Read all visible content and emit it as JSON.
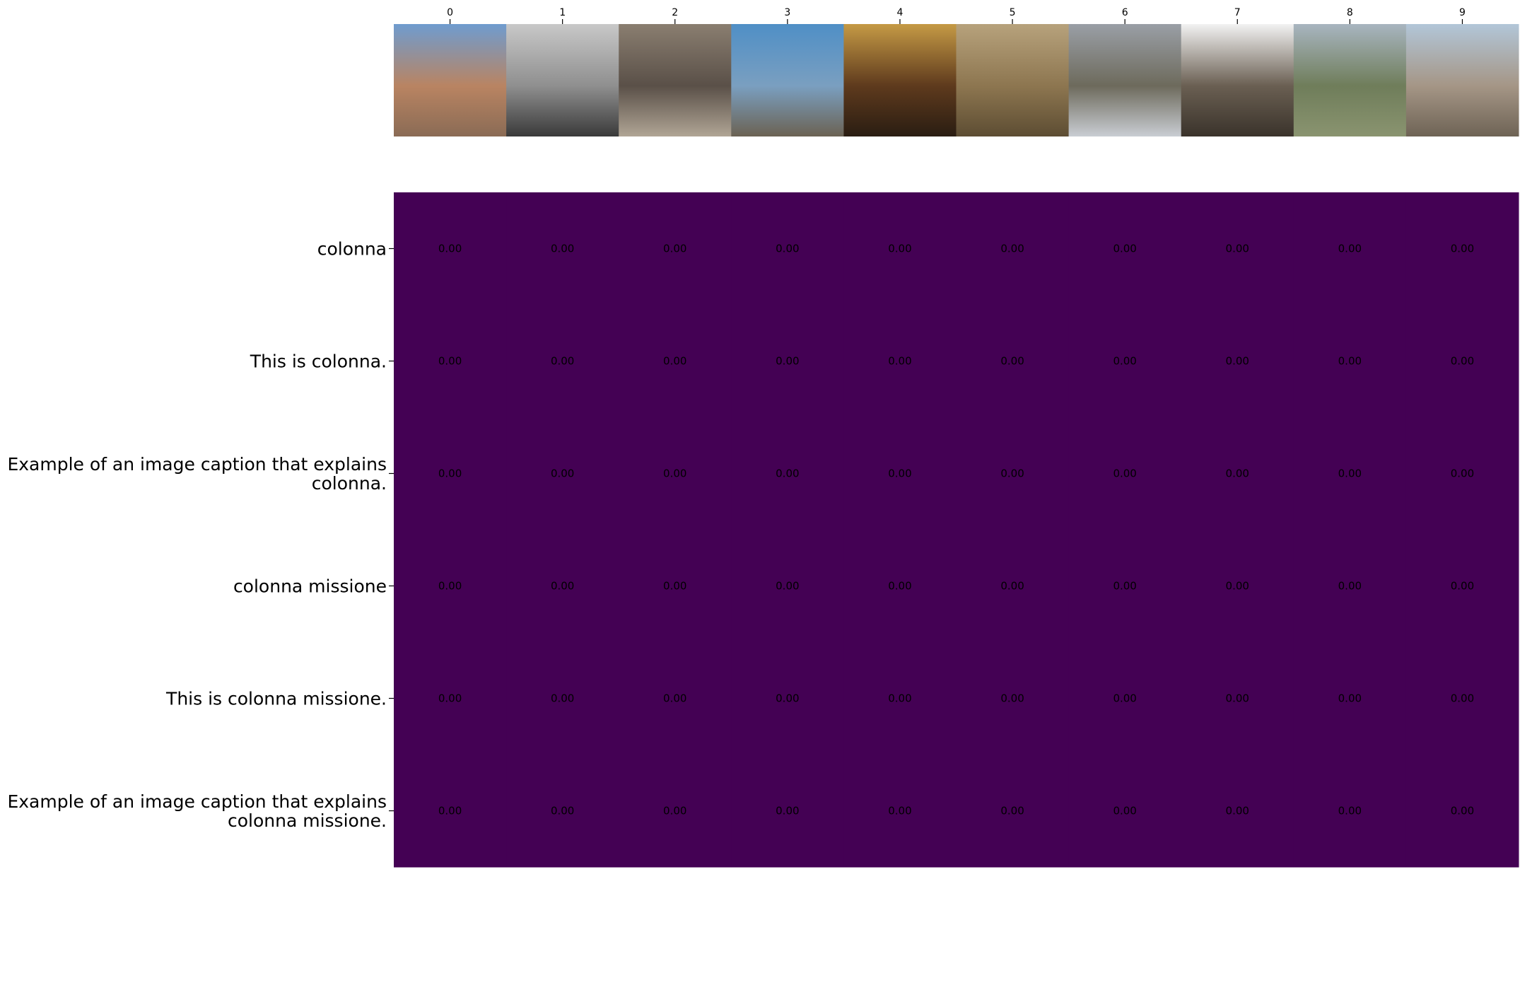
{
  "chart_data": {
    "type": "heatmap",
    "x_tick_labels": [
      "0",
      "1",
      "2",
      "3",
      "4",
      "5",
      "6",
      "7",
      "8",
      "9"
    ],
    "image_thumbnails": [
      {
        "index": "0",
        "subject": "column monument in city square",
        "colors": [
          "#6f9ccf",
          "#b98462",
          "#8a6b55"
        ]
      },
      {
        "index": "1",
        "subject": "white horse, black and white photo",
        "colors": [
          "#c8c8c8",
          "#8f8f8f",
          "#3a3a3a"
        ]
      },
      {
        "index": "2",
        "subject": "ancient temple columns",
        "colors": [
          "#8a7e70",
          "#5a5048",
          "#b0a595"
        ]
      },
      {
        "index": "3",
        "subject": "obelisk against blue sky",
        "colors": [
          "#4f8fc6",
          "#7a9fc0",
          "#6b6253"
        ]
      },
      {
        "index": "4",
        "subject": "subway train interior",
        "colors": [
          "#c59a45",
          "#5e3a1d",
          "#2a1d12"
        ]
      },
      {
        "index": "5",
        "subject": "engraved relief panel",
        "colors": [
          "#b7a27c",
          "#8d7650",
          "#5d4d33"
        ]
      },
      {
        "index": "6",
        "subject": "aqueduct bridge landscape",
        "colors": [
          "#9a9fa6",
          "#6d6a5c",
          "#c9cdd3"
        ]
      },
      {
        "index": "7",
        "subject": "hammer on white background",
        "colors": [
          "#f2f2f2",
          "#6a5f52",
          "#3a332b"
        ]
      },
      {
        "index": "8",
        "subject": "hillside town landscape",
        "colors": [
          "#a8b5c0",
          "#6f7d5a",
          "#8a9470"
        ]
      },
      {
        "index": "9",
        "subject": "church square with tower",
        "colors": [
          "#b2c6d8",
          "#a59686",
          "#6e6355"
        ]
      }
    ],
    "y_tick_labels": [
      [
        "colonna"
      ],
      [
        "This is colonna."
      ],
      [
        "Example of an image caption that explains",
        "colonna."
      ],
      [
        "colonna missione"
      ],
      [
        "This is colonna missione."
      ],
      [
        "Example of an image caption that explains",
        "colonna missione."
      ]
    ],
    "values": [
      [
        0.0,
        0.0,
        0.0,
        0.0,
        0.0,
        0.0,
        0.0,
        0.0,
        0.0,
        0.0
      ],
      [
        0.0,
        0.0,
        0.0,
        0.0,
        0.0,
        0.0,
        0.0,
        0.0,
        0.0,
        0.0
      ],
      [
        0.0,
        0.0,
        0.0,
        0.0,
        0.0,
        0.0,
        0.0,
        0.0,
        0.0,
        0.0
      ],
      [
        0.0,
        0.0,
        0.0,
        0.0,
        0.0,
        0.0,
        0.0,
        0.0,
        0.0,
        0.0
      ],
      [
        0.0,
        0.0,
        0.0,
        0.0,
        0.0,
        0.0,
        0.0,
        0.0,
        0.0,
        0.0
      ],
      [
        0.0,
        0.0,
        0.0,
        0.0,
        0.0,
        0.0,
        0.0,
        0.0,
        0.0,
        0.0
      ]
    ],
    "cell_labels": [
      [
        "0.00",
        "0.00",
        "0.00",
        "0.00",
        "0.00",
        "0.00",
        "0.00",
        "0.00",
        "0.00",
        "0.00"
      ],
      [
        "0.00",
        "0.00",
        "0.00",
        "0.00",
        "0.00",
        "0.00",
        "0.00",
        "0.00",
        "0.00",
        "0.00"
      ],
      [
        "0.00",
        "0.00",
        "0.00",
        "0.00",
        "0.00",
        "0.00",
        "0.00",
        "0.00",
        "0.00",
        "0.00"
      ],
      [
        "0.00",
        "0.00",
        "0.00",
        "0.00",
        "0.00",
        "0.00",
        "0.00",
        "0.00",
        "0.00",
        "0.00"
      ],
      [
        "0.00",
        "0.00",
        "0.00",
        "0.00",
        "0.00",
        "0.00",
        "0.00",
        "0.00",
        "0.00",
        "0.00"
      ],
      [
        "0.00",
        "0.00",
        "0.00",
        "0.00",
        "0.00",
        "0.00",
        "0.00",
        "0.00",
        "0.00",
        "0.00"
      ]
    ],
    "colormap": "viridis",
    "cell_color": "#440154",
    "cell_text_color": "#000000",
    "title": "",
    "xlabel": "",
    "ylabel": "",
    "grid": false,
    "legend": false
  }
}
